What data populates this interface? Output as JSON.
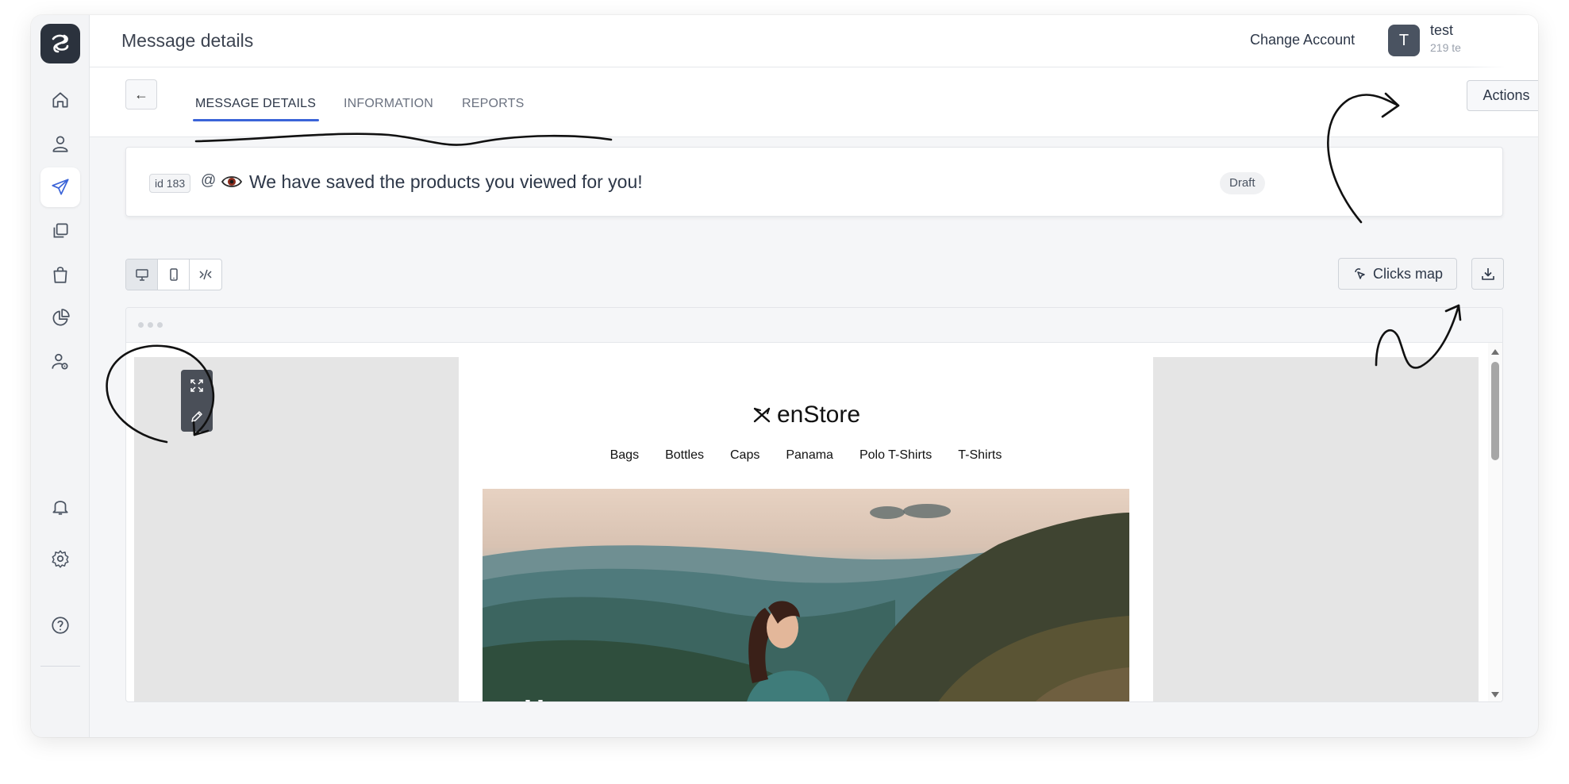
{
  "colors": {
    "accent": "#3b64d8",
    "sidebar_bg": "#f3f4f6",
    "logo_bg": "#2b323d",
    "active_nav_icon": "#3b64d8"
  },
  "sidebar": {
    "logo": "logo-icon",
    "items": [
      {
        "icon": "home-icon",
        "active": false
      },
      {
        "icon": "user-icon",
        "active": false
      },
      {
        "icon": "send-icon",
        "active": true
      },
      {
        "icon": "copy-icon",
        "active": false
      },
      {
        "icon": "shopping-bag-icon",
        "active": false
      },
      {
        "icon": "pie-chart-icon",
        "active": false
      },
      {
        "icon": "user-settings-icon",
        "active": false
      }
    ],
    "bottom": [
      "bell-icon",
      "gear-icon",
      "help-icon"
    ]
  },
  "header": {
    "title": "Message details",
    "change_account": "Change Account",
    "avatar_letter": "T",
    "user_name": "test",
    "user_sub": "219 te"
  },
  "tabs": {
    "back_label": "←",
    "items": [
      {
        "label": "MESSAGE DETAILS",
        "active": true
      },
      {
        "label": "INFORMATION",
        "active": false
      },
      {
        "label": "REPORTS",
        "active": false
      }
    ],
    "actions_label": "Actions"
  },
  "message": {
    "id_label": "id 183",
    "channel_symbol": "@",
    "subject": "We have saved the products you viewed for you!",
    "status": "Draft"
  },
  "toolbar": {
    "views": [
      "desktop-icon",
      "mobile-icon",
      "code-icon"
    ],
    "active_view": "desktop-icon",
    "clicks_map_label": "Clicks map"
  },
  "email_preview": {
    "brand": "enStore",
    "menu": [
      "Bags",
      "Bottles",
      "Caps",
      "Panama",
      "Polo T-Shirts",
      "T-Shirts"
    ],
    "hero_title": "Новая коллекция"
  }
}
